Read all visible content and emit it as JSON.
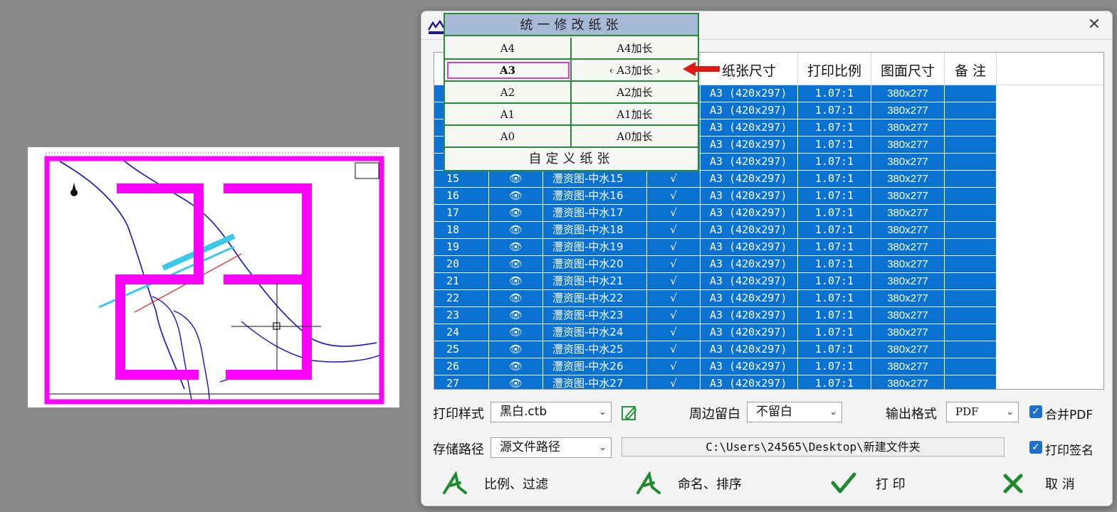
{
  "dialog": {
    "close_symbol": "✕"
  },
  "table": {
    "headers": [
      "纸张尺寸",
      "打印比例",
      "图面尺寸",
      "备 注"
    ],
    "partial_rows": [
      {
        "paper": "A3 (420x297)",
        "scale": "1.07:1",
        "size": "380x277"
      },
      {
        "paper": "A3 (420x297)",
        "scale": "1.07:1",
        "size": "380x277"
      },
      {
        "paper": "A3 (420x297)",
        "scale": "1.07:1",
        "size": "380x277"
      },
      {
        "paper": "A3 (420x297)",
        "scale": "1.07:1",
        "size": "380x277"
      },
      {
        "paper": "A3 (420x297)",
        "scale": "1.07:1",
        "size": "380x277"
      }
    ],
    "rows": [
      {
        "num": "15",
        "name": "灃资图-中水15",
        "paper": "A3 (420x297)",
        "scale": "1.07:1",
        "size": "380x277"
      },
      {
        "num": "16",
        "name": "灃资图-中水16",
        "paper": "A3 (420x297)",
        "scale": "1.07:1",
        "size": "380x277"
      },
      {
        "num": "17",
        "name": "灃资图-中水17",
        "paper": "A3 (420x297)",
        "scale": "1.07:1",
        "size": "380x277"
      },
      {
        "num": "18",
        "name": "灃资图-中水18",
        "paper": "A3 (420x297)",
        "scale": "1.07:1",
        "size": "380x277"
      },
      {
        "num": "19",
        "name": "灃资图-中水19",
        "paper": "A3 (420x297)",
        "scale": "1.07:1",
        "size": "380x277"
      },
      {
        "num": "20",
        "name": "灃资图-中水20",
        "paper": "A3 (420x297)",
        "scale": "1.07:1",
        "size": "380x277"
      },
      {
        "num": "21",
        "name": "灃资图-中水21",
        "paper": "A3 (420x297)",
        "scale": "1.07:1",
        "size": "380x277"
      },
      {
        "num": "22",
        "name": "灃资图-中水22",
        "paper": "A3 (420x297)",
        "scale": "1.07:1",
        "size": "380x277"
      },
      {
        "num": "23",
        "name": "灃资图-中水23",
        "paper": "A3 (420x297)",
        "scale": "1.07:1",
        "size": "380x277"
      },
      {
        "num": "24",
        "name": "灃资图-中水24",
        "paper": "A3 (420x297)",
        "scale": "1.07:1",
        "size": "380x277"
      },
      {
        "num": "25",
        "name": "灃资图-中水25",
        "paper": "A3 (420x297)",
        "scale": "1.07:1",
        "size": "380x277"
      },
      {
        "num": "26",
        "name": "灃资图-中水26",
        "paper": "A3 (420x297)",
        "scale": "1.07:1",
        "size": "380x277"
      },
      {
        "num": "27",
        "name": "灃资图-中水27",
        "paper": "A3 (420x297)",
        "scale": "1.07:1",
        "size": "380x277"
      }
    ],
    "eye_symbol": "👁",
    "check_symbol": "√"
  },
  "popup": {
    "title": "统一修改纸张",
    "rows": [
      {
        "left": "A4",
        "right": "A4加长"
      },
      {
        "left": "A3",
        "right": "‹ A3加长 ›"
      },
      {
        "left": "A2",
        "right": "A2加长"
      },
      {
        "left": "A1",
        "right": "A1加长"
      },
      {
        "left": "A0",
        "right": "A0加长"
      }
    ],
    "custom": "自定义纸张"
  },
  "controls": {
    "print_style_label": "打印样式",
    "print_style_value": "黑白.ctb",
    "margin_label": "周边留白",
    "margin_value": "不留白",
    "output_format_label": "输出格式",
    "output_format_value": "PDF",
    "merge_pdf_label": "合并PDF",
    "merge_pdf_checked": true,
    "save_path_label": "存储路径",
    "save_path_value": "源文件路径",
    "path_text": "C:\\Users\\24565\\Desktop\\新建文件夹",
    "print_sign_label": "打印签名",
    "print_sign_checked": true
  },
  "actions": {
    "scale_filter": "比例、过滤",
    "name_sort": "命名、排序",
    "print": "打 印",
    "cancel": "取 消"
  },
  "colors": {
    "selection_blue": "#0a72d0",
    "popup_green": "#2a8a3a",
    "magenta": "#ff00ff",
    "arrow_red": "#e01818"
  }
}
